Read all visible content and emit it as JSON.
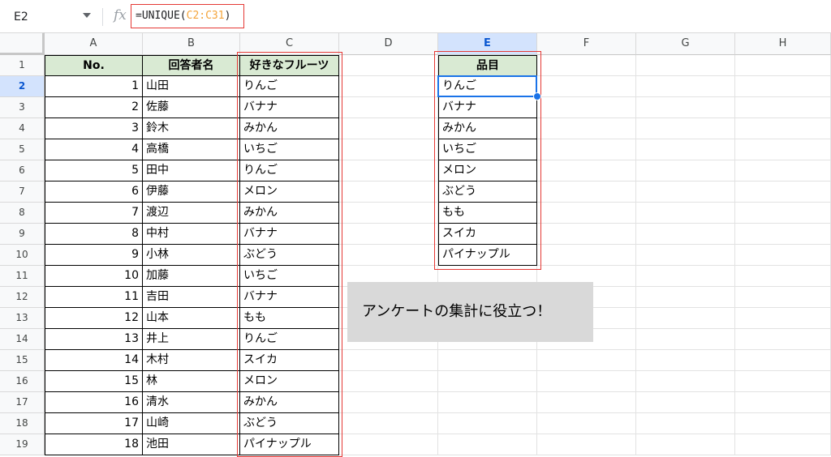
{
  "formula_bar": {
    "name_box": "E2",
    "fx_label": "fx",
    "formula_prefix": "=UNIQUE(",
    "formula_ref": "C2:C31",
    "formula_suffix": ")"
  },
  "columns": [
    "A",
    "B",
    "C",
    "D",
    "E",
    "F",
    "G",
    "H"
  ],
  "selected_column": "E",
  "rows": [
    "1",
    "2",
    "3",
    "4",
    "5",
    "6",
    "7",
    "8",
    "9",
    "10",
    "11",
    "12",
    "13",
    "14",
    "15",
    "16",
    "17",
    "18",
    "19"
  ],
  "selected_row": "2",
  "table_headers": {
    "no": "No.",
    "name": "回答者名",
    "fruit": "好きなフルーツ"
  },
  "table_rows": [
    {
      "no": "1",
      "name": "山田",
      "fruit": "りんご"
    },
    {
      "no": "2",
      "name": "佐藤",
      "fruit": "バナナ"
    },
    {
      "no": "3",
      "name": "鈴木",
      "fruit": "みかん"
    },
    {
      "no": "4",
      "name": "高橋",
      "fruit": "いちご"
    },
    {
      "no": "5",
      "name": "田中",
      "fruit": "りんご"
    },
    {
      "no": "6",
      "name": "伊藤",
      "fruit": "メロン"
    },
    {
      "no": "7",
      "name": "渡辺",
      "fruit": "みかん"
    },
    {
      "no": "8",
      "name": "中村",
      "fruit": "バナナ"
    },
    {
      "no": "9",
      "name": "小林",
      "fruit": "ぶどう"
    },
    {
      "no": "10",
      "name": "加藤",
      "fruit": "いちご"
    },
    {
      "no": "11",
      "name": "吉田",
      "fruit": "バナナ"
    },
    {
      "no": "12",
      "name": "山本",
      "fruit": "もも"
    },
    {
      "no": "13",
      "name": "井上",
      "fruit": "りんご"
    },
    {
      "no": "14",
      "name": "木村",
      "fruit": "スイカ"
    },
    {
      "no": "15",
      "name": "林",
      "fruit": "メロン"
    },
    {
      "no": "16",
      "name": "清水",
      "fruit": "みかん"
    },
    {
      "no": "17",
      "name": "山崎",
      "fruit": "ぶどう"
    },
    {
      "no": "18",
      "name": "池田",
      "fruit": "パイナップル"
    }
  ],
  "unique_header": "品目",
  "unique_items": [
    "りんご",
    "バナナ",
    "みかん",
    "いちご",
    "メロン",
    "ぶどう",
    "もも",
    "スイカ",
    "パイナップル"
  ],
  "note": "アンケートの集計に役立つ！",
  "colors": {
    "accent": "#1a73e8",
    "highlight_border": "#e53935",
    "header_fill": "#d9ead3",
    "note_fill": "#d9d9d9"
  }
}
